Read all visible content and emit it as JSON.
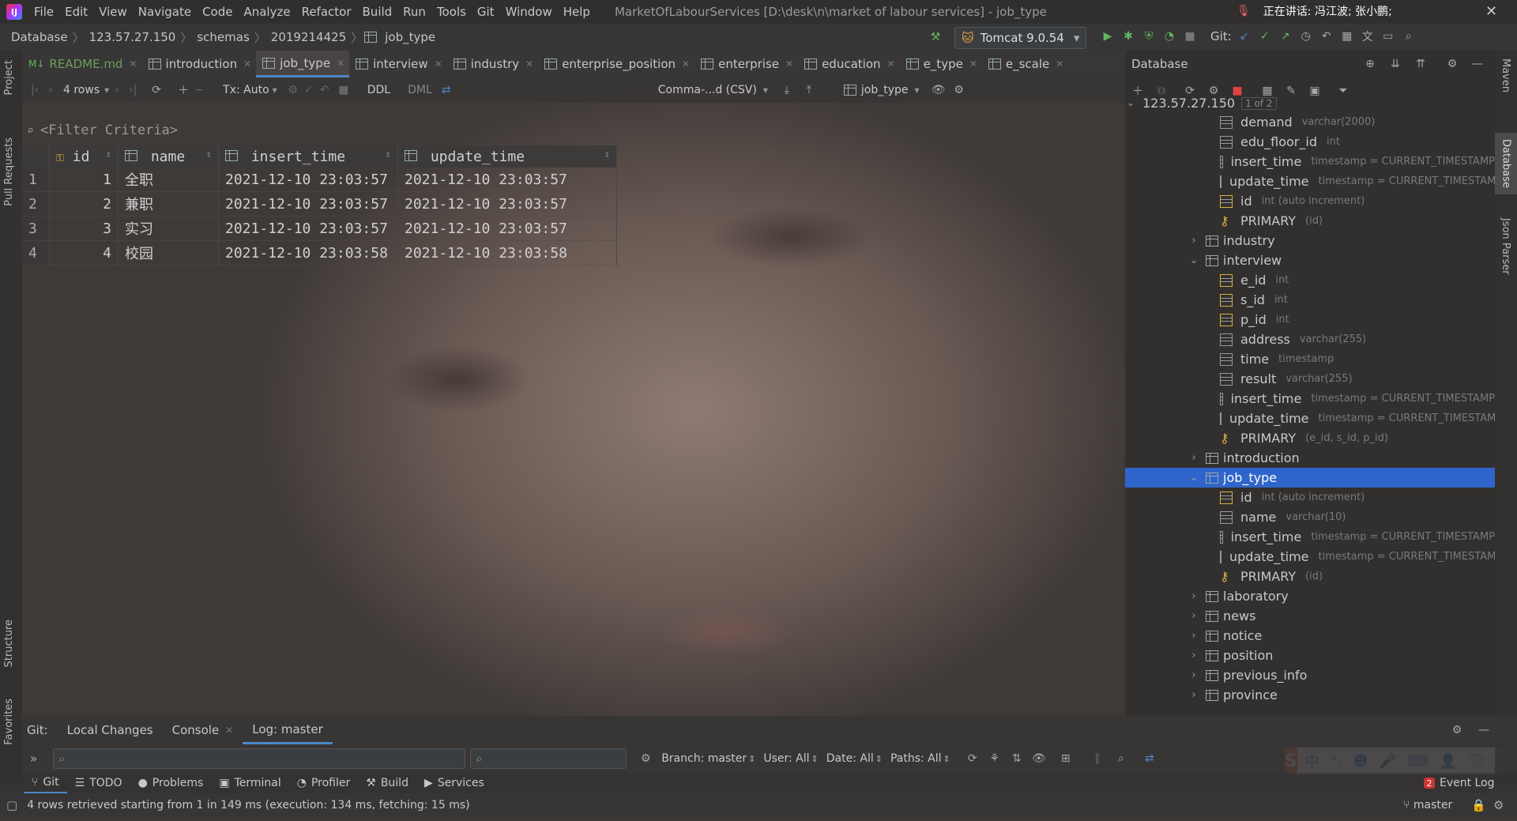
{
  "menubar": {
    "items": [
      "File",
      "Edit",
      "View",
      "Navigate",
      "Code",
      "Analyze",
      "Refactor",
      "Build",
      "Run",
      "Tools",
      "Git",
      "Window",
      "Help"
    ],
    "window_title": "MarketOfLabourServices [D:\\desk\\n\\market of labour services] - job_type",
    "ime_status": "正在讲话: 冯江波; 张小鹏;"
  },
  "navbar": {
    "breadcrumbs": [
      "Database",
      "123.57.27.150",
      "schemas",
      "2019214425",
      "job_type"
    ],
    "run_config": "Tomcat 9.0.54",
    "git_label": "Git:"
  },
  "tabs": [
    {
      "label": "README.md",
      "active": false
    },
    {
      "label": "introduction",
      "active": false
    },
    {
      "label": "job_type",
      "active": true
    },
    {
      "label": "interview",
      "active": false
    },
    {
      "label": "industry",
      "active": false
    },
    {
      "label": "enterprise_position",
      "active": false
    },
    {
      "label": "enterprise",
      "active": false
    },
    {
      "label": "education",
      "active": false
    },
    {
      "label": "e_type",
      "active": false
    },
    {
      "label": "e_scale",
      "active": false
    }
  ],
  "toolbar": {
    "rows": "4 rows",
    "tx": "Tx: Auto",
    "ddl": "DDL",
    "dml": "DML",
    "export_format": "Comma-...d (CSV)",
    "table_selector": "job_type"
  },
  "filter": {
    "placeholder": "<Filter Criteria>"
  },
  "grid": {
    "columns": [
      "id",
      "name",
      "insert_time",
      "update_time"
    ],
    "rows": [
      {
        "n": "1",
        "id": "1",
        "name": "全职",
        "insert_time": "2021-12-10 23:03:57",
        "update_time": "2021-12-10 23:03:57"
      },
      {
        "n": "2",
        "id": "2",
        "name": "兼职",
        "insert_time": "2021-12-10 23:03:57",
        "update_time": "2021-12-10 23:03:57"
      },
      {
        "n": "3",
        "id": "3",
        "name": "实习",
        "insert_time": "2021-12-10 23:03:57",
        "update_time": "2021-12-10 23:03:57"
      },
      {
        "n": "4",
        "id": "4",
        "name": "校园",
        "insert_time": "2021-12-10 23:03:58",
        "update_time": "2021-12-10 23:03:58"
      }
    ]
  },
  "database": {
    "title": "Database",
    "host": "123.57.27.150",
    "host_badge": "1 of 2",
    "tree": [
      {
        "kind": "col",
        "label": "demand",
        "type": "varchar(2000)"
      },
      {
        "kind": "col",
        "label": "edu_floor_id",
        "type": "int"
      },
      {
        "kind": "col",
        "label": "insert_time",
        "type": "timestamp = CURRENT_TIMESTAMP"
      },
      {
        "kind": "col",
        "label": "update_time",
        "type": "timestamp = CURRENT_TIMESTAMP"
      },
      {
        "kind": "pk",
        "label": "id",
        "type": "int (auto increment)"
      },
      {
        "kind": "key",
        "label": "PRIMARY",
        "type": "(id)"
      },
      {
        "kind": "table",
        "label": "industry",
        "expanded": false
      },
      {
        "kind": "table",
        "label": "interview",
        "expanded": true
      },
      {
        "kind": "pk",
        "label": "e_id",
        "type": "int"
      },
      {
        "kind": "pk",
        "label": "s_id",
        "type": "int"
      },
      {
        "kind": "pk",
        "label": "p_id",
        "type": "int"
      },
      {
        "kind": "col",
        "label": "address",
        "type": "varchar(255)"
      },
      {
        "kind": "col",
        "label": "time",
        "type": "timestamp"
      },
      {
        "kind": "col",
        "label": "result",
        "type": "varchar(255)"
      },
      {
        "kind": "col",
        "label": "insert_time",
        "type": "timestamp = CURRENT_TIMESTAMP"
      },
      {
        "kind": "col",
        "label": "update_time",
        "type": "timestamp = CURRENT_TIMESTAMP"
      },
      {
        "kind": "key",
        "label": "PRIMARY",
        "type": "(e_id, s_id, p_id)"
      },
      {
        "kind": "table",
        "label": "introduction",
        "expanded": false
      },
      {
        "kind": "table",
        "label": "job_type",
        "expanded": true,
        "selected": true
      },
      {
        "kind": "pk",
        "label": "id",
        "type": "int (auto increment)"
      },
      {
        "kind": "col",
        "label": "name",
        "type": "varchar(10)"
      },
      {
        "kind": "col",
        "label": "insert_time",
        "type": "timestamp = CURRENT_TIMESTAMP"
      },
      {
        "kind": "col",
        "label": "update_time",
        "type": "timestamp = CURRENT_TIMESTAMP"
      },
      {
        "kind": "key",
        "label": "PRIMARY",
        "type": "(id)"
      },
      {
        "kind": "table",
        "label": "laboratory",
        "expanded": false
      },
      {
        "kind": "table",
        "label": "news",
        "expanded": false
      },
      {
        "kind": "table",
        "label": "notice",
        "expanded": false
      },
      {
        "kind": "table",
        "label": "position",
        "expanded": false
      },
      {
        "kind": "table",
        "label": "previous_info",
        "expanded": false
      },
      {
        "kind": "table",
        "label": "province",
        "expanded": false
      }
    ]
  },
  "left_strip": [
    "Project",
    "Pull Requests",
    "Structure",
    "Favorites"
  ],
  "right_strip": [
    "Maven",
    "Database",
    "Json Parser"
  ],
  "bottom": {
    "git_label": "Git:",
    "tabs": [
      "Local Changes",
      "Console",
      "Log: master"
    ],
    "branch": "Branch: master",
    "user": "User: All",
    "date": "Date: All",
    "paths": "Paths: All"
  },
  "toolwindows": [
    "Git",
    "TODO",
    "Problems",
    "Terminal",
    "Profiler",
    "Build",
    "Services"
  ],
  "event_log": {
    "count": "2",
    "label": "Event Log"
  },
  "status": {
    "message": "4 rows retrieved starting from 1 in 149 ms (execution: 134 ms, fetching: 15 ms)",
    "branch": "master"
  },
  "ime": {
    "logo": "S",
    "mode": "中"
  }
}
